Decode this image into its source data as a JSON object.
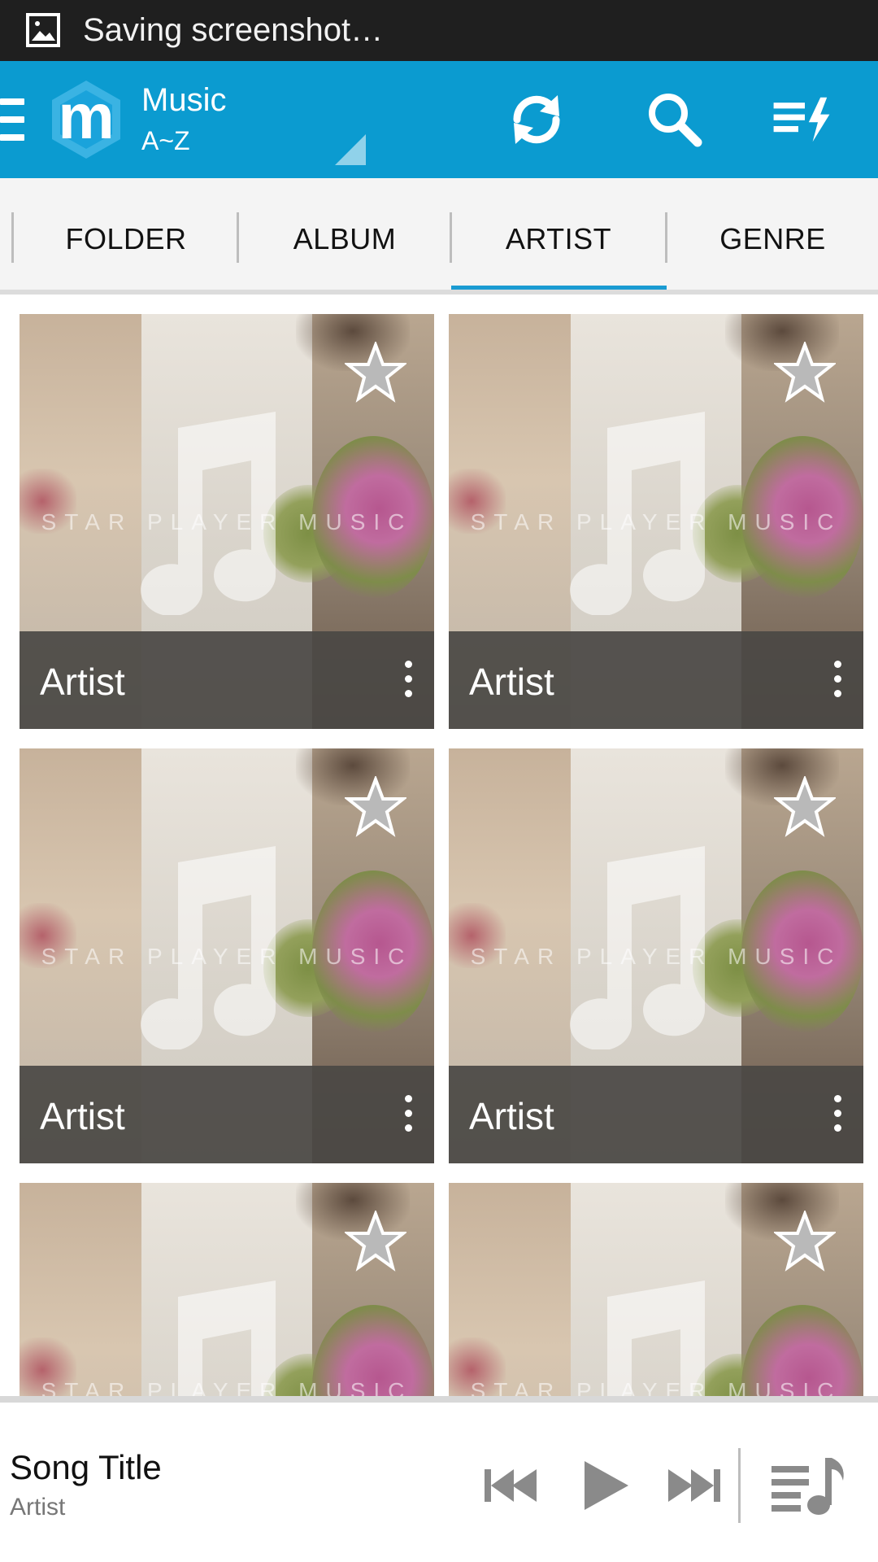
{
  "status_bar": {
    "text": "Saving screenshot…"
  },
  "app_bar": {
    "title": "Music",
    "subtitle": "A~Z",
    "logo_letter": "m",
    "actions": [
      "sync-icon",
      "search-icon",
      "queue-lightning-icon"
    ]
  },
  "tabs": [
    {
      "label": "FOLDER",
      "selected": false
    },
    {
      "label": "ALBUM",
      "selected": false
    },
    {
      "label": "ARTIST",
      "selected": true
    },
    {
      "label": "GENRE",
      "selected": false
    }
  ],
  "grid": {
    "watermark": "STAR PLAYER MUSIC",
    "items": [
      {
        "label": "Artist"
      },
      {
        "label": "Artist"
      },
      {
        "label": "Artist"
      },
      {
        "label": "Artist"
      },
      {
        "label": ""
      },
      {
        "label": ""
      }
    ]
  },
  "now_playing": {
    "title": "Song Title",
    "artist": "Artist"
  },
  "colors": {
    "app_bar": "#0b9bd0",
    "tab_indicator": "#1a9bd2",
    "status_bar": "#1f1f1f"
  }
}
